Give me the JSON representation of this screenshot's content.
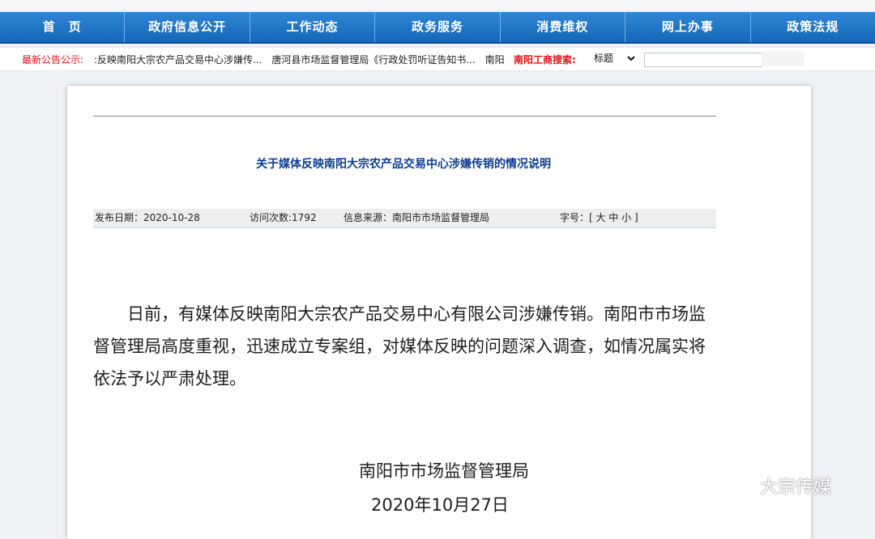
{
  "nav": {
    "items": [
      {
        "label": "首　页"
      },
      {
        "label": "政府信息公开"
      },
      {
        "label": "工作动态"
      },
      {
        "label": "政务服务"
      },
      {
        "label": "消费维权"
      },
      {
        "label": "网上办事"
      },
      {
        "label": "政策法规"
      }
    ]
  },
  "notice": {
    "label": "最新公告公示:",
    "items": [
      ":反映南阳大宗农产品交易中心涉嫌传...",
      "唐河县市场监督管理局《行政处罚听证告知书...",
      "南阳"
    ]
  },
  "search": {
    "label": "南阳工商搜索:",
    "select_value": "标题",
    "input_value": ""
  },
  "article": {
    "title": "关于媒体反映南阳大宗农产品交易中心涉嫌传销的情况说明",
    "meta": {
      "publish_date": "发布日期：2020-10-28",
      "visits": "访问次数:1792",
      "source": "信息来源：南阳市市场监督管理局",
      "font_size": "字号：[ 大 中 小 ]"
    },
    "body": "日前，有媒体反映南阳大宗农产品交易中心有限公司涉嫌传销。南阳市市场监督管理局高度重视，迅速成立专案组，对媒体反映的问题深入调查，如情况属实将依法予以严肃处理。",
    "signature": "南阳市市场监督管理局",
    "date": "2020年10月27日"
  },
  "watermark": {
    "text": "大宗传媒",
    "icon": "wechat-icon"
  },
  "colors": {
    "nav_blue": "#1567b9",
    "notice_red": "#dd1111",
    "title_blue": "#0b3d91"
  }
}
